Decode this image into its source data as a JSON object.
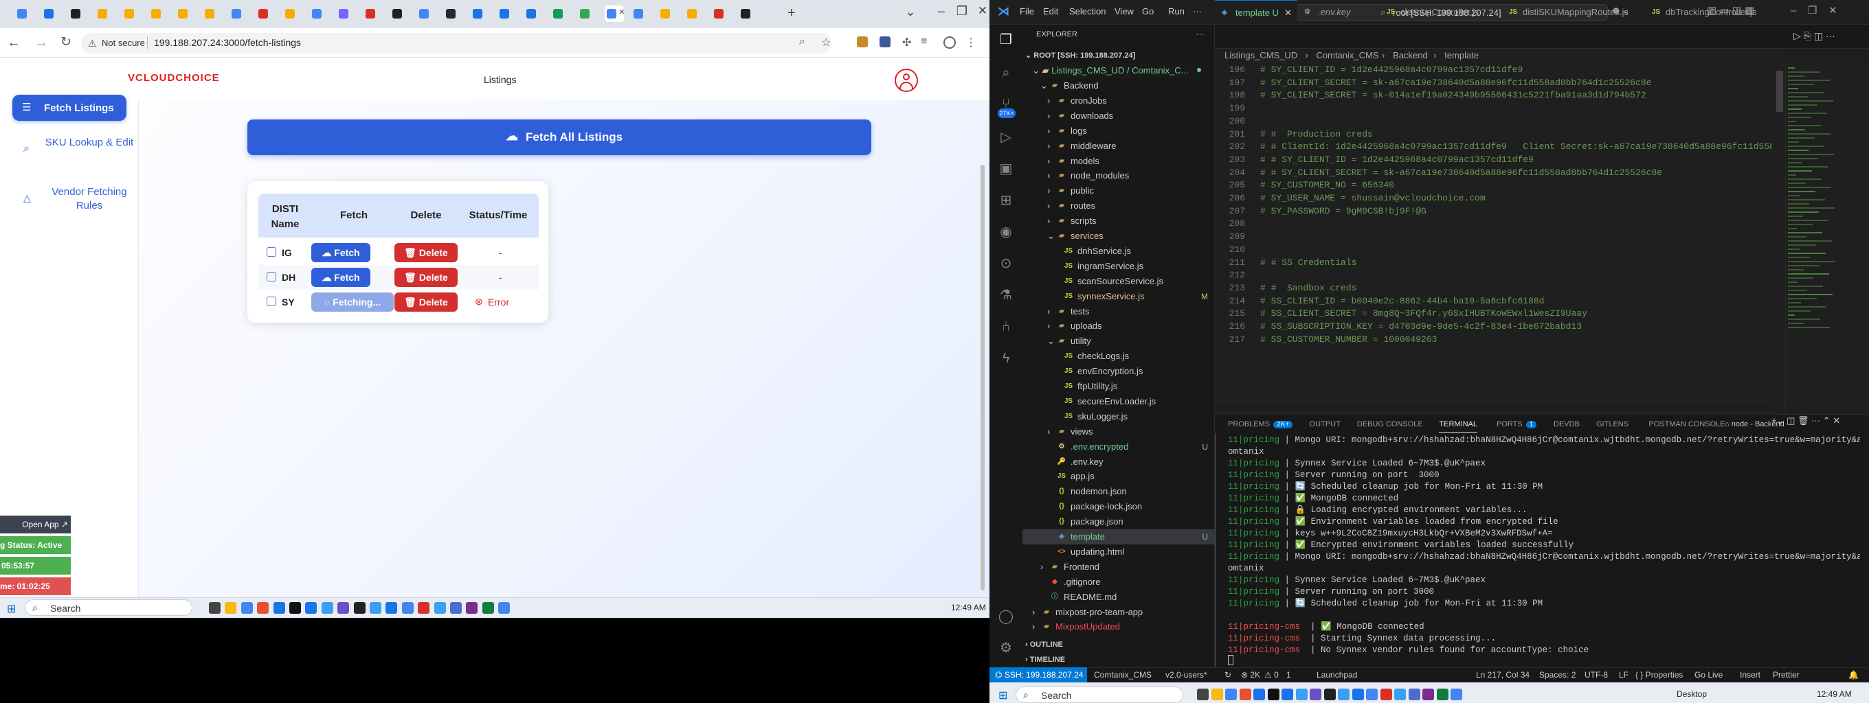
{
  "chrome": {
    "tab_count": 28,
    "url_not_secure": "Not secure",
    "url": "199.188.207.24:3000/fetch-listings",
    "new_tab": "+",
    "brand_logo": "VCLOUDCHOICE",
    "nav_listings": "Listings",
    "sidebar": {
      "items": [
        {
          "label": "Fetch Listings",
          "icon": "list-icon",
          "active": true
        },
        {
          "label": "SKU Lookup & Edit",
          "icon": "search-icon",
          "active": false
        },
        {
          "label": "Vendor Fetching Rules",
          "icon": "warning-icon",
          "active": false
        }
      ]
    },
    "fetch_all_label": "Fetch All Listings",
    "table": {
      "headers": [
        "DISTI Name",
        "Fetch",
        "Delete",
        "Status/Time"
      ],
      "rows": [
        {
          "name": "IG",
          "fetch": "Fetch",
          "delete": "Delete",
          "status": "-"
        },
        {
          "name": "DH",
          "fetch": "Fetch",
          "delete": "Delete",
          "status": "-"
        },
        {
          "name": "SY",
          "fetch": "Fetching...",
          "delete": "Delete",
          "status": "Error"
        }
      ]
    },
    "widget": {
      "open_app": "Open App ↗",
      "status": "g Status: Active",
      "time1": "05:53:57",
      "time2": "me: 01:02:25"
    },
    "taskbar": {
      "search": "Search",
      "time": "12:49 AM"
    }
  },
  "vscode": {
    "menu": [
      "File",
      "Edit",
      "Selection",
      "View",
      "Go",
      "Run",
      "···"
    ],
    "search": "root [SSH: 199.188.207.24]",
    "explorer_title": "EXPLORER",
    "root_label": "ROOT [SSH: 199.188.207.24]",
    "project": "Listings_CMS_UD / Comtanix_C...",
    "tree": [
      {
        "label": "Backend",
        "kind": "folder-open",
        "depth": 1
      },
      {
        "label": "cronJobs",
        "kind": "folder",
        "depth": 2
      },
      {
        "label": "downloads",
        "kind": "folder",
        "depth": 2
      },
      {
        "label": "logs",
        "kind": "folder",
        "depth": 2
      },
      {
        "label": "middleware",
        "kind": "folder",
        "depth": 2
      },
      {
        "label": "models",
        "kind": "folder",
        "depth": 2
      },
      {
        "label": "node_modules",
        "kind": "folder",
        "depth": 2
      },
      {
        "label": "public",
        "kind": "folder",
        "depth": 2
      },
      {
        "label": "routes",
        "kind": "folder",
        "depth": 2
      },
      {
        "label": "scripts",
        "kind": "folder",
        "depth": 2
      },
      {
        "label": "services",
        "kind": "folder-open",
        "depth": 2,
        "color": "#e2c08d"
      },
      {
        "label": "dnhService.js",
        "kind": "js",
        "depth": 3
      },
      {
        "label": "ingramService.js",
        "kind": "js",
        "depth": 3
      },
      {
        "label": "scanSourceService.js",
        "kind": "js",
        "depth": 3
      },
      {
        "label": "synnexService.js",
        "kind": "js",
        "depth": 3,
        "badge": "M",
        "color": "#e2c08d"
      },
      {
        "label": "tests",
        "kind": "folder",
        "depth": 2
      },
      {
        "label": "uploads",
        "kind": "folder",
        "depth": 2
      },
      {
        "label": "utility",
        "kind": "folder-open",
        "depth": 2
      },
      {
        "label": "checkLogs.js",
        "kind": "js",
        "depth": 3
      },
      {
        "label": "envEncryption.js",
        "kind": "js",
        "depth": 3
      },
      {
        "label": "ftpUtility.js",
        "kind": "js",
        "depth": 3
      },
      {
        "label": "secureEnvLoader.js",
        "kind": "js",
        "depth": 3
      },
      {
        "label": "skuLogger.js",
        "kind": "js",
        "depth": 3
      },
      {
        "label": "views",
        "kind": "folder",
        "depth": 2
      },
      {
        "label": ".env.encrypted",
        "kind": "env",
        "depth": 2,
        "badge": "U",
        "color": "#73c991"
      },
      {
        "label": ".env.key",
        "kind": "key",
        "depth": 2
      },
      {
        "label": "app.js",
        "kind": "js",
        "depth": 2
      },
      {
        "label": "nodemon.json",
        "kind": "json",
        "depth": 2
      },
      {
        "label": "package-lock.json",
        "kind": "json",
        "depth": 2
      },
      {
        "label": "package.json",
        "kind": "json",
        "depth": 2
      },
      {
        "label": "template",
        "kind": "template",
        "depth": 2,
        "badge": "U",
        "color": "#73c991",
        "selected": true
      },
      {
        "label": "updating.html",
        "kind": "html",
        "depth": 2
      },
      {
        "label": "Frontend",
        "kind": "folder",
        "depth": 1
      },
      {
        "label": ".gitignore",
        "kind": "git",
        "depth": 1
      },
      {
        "label": "README.md",
        "kind": "md",
        "depth": 1
      },
      {
        "label": "mixpost-pro-team-app",
        "kind": "folder",
        "depth": 0
      },
      {
        "label": "MixpostUpdated",
        "kind": "folder",
        "depth": 0,
        "color": "#f14c4c"
      }
    ],
    "outline": "OUTLINE",
    "timeline": "TIMELINE",
    "tabs": [
      "template U",
      ".env.key",
      "cleanupController.js",
      "distiSKUMappingRoutes.js",
      "dbTrackingController.js"
    ],
    "breadcrumb": [
      "Listings_CMS_UD",
      "Comtanix_CMS",
      "Backend",
      "template"
    ],
    "lines": [
      {
        "n": "196",
        "t": "# SY_CLIENT_ID = 1d2e4425968a4c0799ac1357cd11dfe9"
      },
      {
        "n": "197",
        "t": "# SY_CLIENT_SECRET = sk-a67ca19e738640d5a88e96fc11d558ad8bb764d1c25526c8e"
      },
      {
        "n": "198",
        "t": "# SY_CLIENT_SECRET = sk-014a1ef19a024349b95566431c5221fba91aa3d1d794b572"
      },
      {
        "n": "199",
        "t": ""
      },
      {
        "n": "200",
        "t": ""
      },
      {
        "n": "201",
        "t": "# #  Production creds"
      },
      {
        "n": "202",
        "t": "# # ClientId: 1d2e4425968a4c0799ac1357cd11dfe9   Client Secret:sk-a67ca19e738640d5a88e96fc11d558ad8b"
      },
      {
        "n": "203",
        "t": "# # SY_CLIENT_ID = 1d2e4425968a4c0799ac1357cd11dfe9"
      },
      {
        "n": "204",
        "t": "# # SY_CLIENT_SECRET = sk-a67ca19e738640d5a88e96fc11d558ad8bb764d1c25526c8e"
      },
      {
        "n": "205",
        "t": "# SY_CUSTOMER_NO = 656340"
      },
      {
        "n": "206",
        "t": "# SY_USER_NAME = shussain@vcloudchoice.com"
      },
      {
        "n": "207",
        "t": "# SY_PASSWORD = 9gM9CSB!bj9F!@G"
      },
      {
        "n": "208",
        "t": ""
      },
      {
        "n": "209",
        "t": ""
      },
      {
        "n": "210",
        "t": ""
      },
      {
        "n": "211",
        "t": "# # SS Credentials"
      },
      {
        "n": "212",
        "t": ""
      },
      {
        "n": "213",
        "t": "# #  Sandbox creds"
      },
      {
        "n": "214",
        "t": "# SS_CLIENT_ID = b0040e2c-8862-44b4-ba10-5a6cbfc6188d"
      },
      {
        "n": "215",
        "t": "# SS_CLIENT_SECRET = 8mg8Q~3FQf4r.y6SxIHUBTKoWEWxl1WesZI9Uaay"
      },
      {
        "n": "216",
        "t": "# SS_SUBSCRIPTION_KEY = d4703d9e-9de5-4c2f-83e4-1be672babd13"
      },
      {
        "n": "217",
        "t": "# SS_CUSTOMER_NUMBER = 1000049263"
      }
    ],
    "panel_tabs": [
      {
        "label": "PROBLEMS",
        "badge": "2K+"
      },
      {
        "label": "OUTPUT"
      },
      {
        "label": "DEBUG CONSOLE"
      },
      {
        "label": "TERMINAL",
        "active": true
      },
      {
        "label": "PORTS",
        "badge": "1"
      },
      {
        "label": "DEVDB"
      },
      {
        "label": "GITLENS"
      },
      {
        "label": "POSTMAN CONSOLE"
      }
    ],
    "terminal_name": "node - Backend",
    "terminal": [
      {
        "p": "11|pricing",
        "t": " | Mongo URI: mongodb+srv://hshahzad:bhaN8HZwQ4H86jCr@comtanix.wjtbdht.mongodb.net/?retryWrites=true&w=majority&appName=C"
      },
      {
        "p": "",
        "t": "omtanix"
      },
      {
        "p": "11|pricing",
        "t": " | Synnex Service Loaded 6~7M3$.@uK^paex"
      },
      {
        "p": "11|pricing",
        "t": " | Server running on port  3000"
      },
      {
        "p": "11|pricing",
        "t": " | 🔄 Scheduled cleanup job for Mon-Fri at 11:30 PM"
      },
      {
        "p": "11|pricing",
        "t": " | ✅ MongoDB connected"
      },
      {
        "p": "11|pricing",
        "t": " | 🔒 Loading encrypted environment variables..."
      },
      {
        "p": "11|pricing",
        "t": " | ✅ Environment variables loaded from encrypted file"
      },
      {
        "p": "11|pricing",
        "t": " | keys w++9L2CoC8Z19mxuycH3LkbQr+VXBeM2v3XwRFDSwf+A="
      },
      {
        "p": "11|pricing",
        "t": " | ✅ Encrypted environment variables loaded successfully"
      },
      {
        "p": "11|pricing",
        "t": " | Mongo URI: mongodb+srv://hshahzad:bhaN8HZwQ4H86jCr@comtanix.wjtbdht.mongodb.net/?retryWrites=true&w=majority&appName=C"
      },
      {
        "p": "",
        "t": "omtanix"
      },
      {
        "p": "11|pricing",
        "t": " | Synnex Service Loaded 6~7M3$.@uK^paex"
      },
      {
        "p": "11|pricing",
        "t": " | Server running on port 3000"
      },
      {
        "p": "11|pricing",
        "t": " | 🔄 Scheduled cleanup job for Mon-Fri at 11:30 PM"
      },
      {
        "p": "",
        "t": ""
      },
      {
        "p": "11|pricing-cms",
        "t": "  | ✅ MongoDB connected"
      },
      {
        "p": "11|pricing-cms",
        "t": "  | Starting Synnex data processing..."
      },
      {
        "p": "11|pricing-cms",
        "t": "  | No Synnex vendor rules found for accountType: choice"
      }
    ],
    "status": {
      "remote": "SSH: 199.188.207.24",
      "branch": "Comtanix_CMS",
      "version": "v2.0-users*",
      "sync": "↻",
      "errors": "⊗ 2K",
      "warnings": "⚠ 0",
      "ports": "1",
      "launchpad": "Launchpad",
      "position": "Ln 217, Col 34",
      "spaces": "Spaces: 2",
      "encoding": "UTF-8",
      "eol": "LF",
      "lang": "{ } Properties",
      "golive": "Go Live",
      "insert": "Insert",
      "prettier": "Prettier"
    },
    "taskbar": {
      "search": "Search",
      "desktop": "Desktop",
      "time": "12:49 AM"
    }
  }
}
